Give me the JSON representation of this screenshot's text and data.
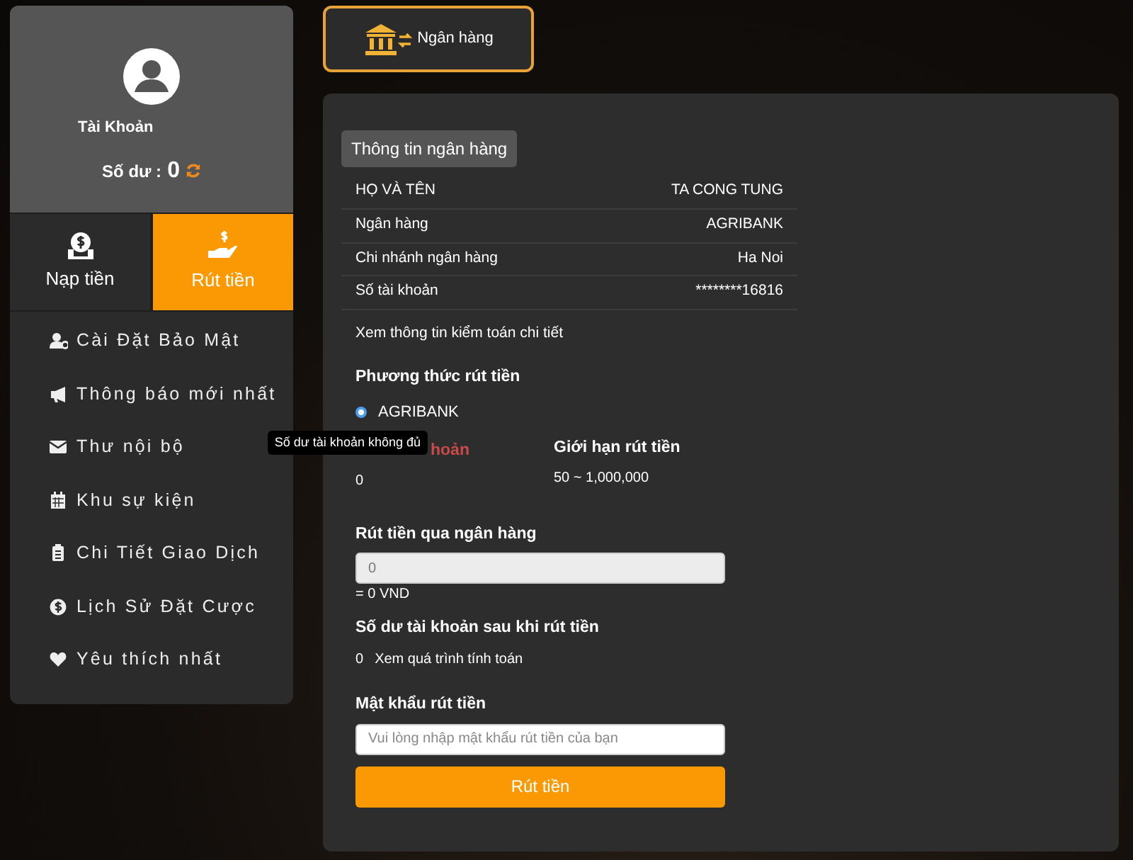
{
  "profile": {
    "account_label": "Tài Khoản",
    "balance_label": "Số dư :",
    "balance": "0"
  },
  "actions": [
    {
      "kind": "deposit",
      "label": "Nạp tiền",
      "selected": false
    },
    {
      "kind": "withdraw",
      "label": "Rút tiền",
      "selected": true
    }
  ],
  "menu": [
    {
      "kind": "security",
      "label": "Cài Đặt Bảo Mật"
    },
    {
      "kind": "megaphone",
      "label": "Thông báo mới nhất"
    },
    {
      "kind": "mail",
      "label": "Thư nội bộ"
    },
    {
      "kind": "calendar",
      "label": "Khu sự kiện"
    },
    {
      "kind": "clipboard",
      "label": "Chi Tiết Giao Dịch"
    },
    {
      "kind": "coin",
      "label": "Lịch Sử Đặt Cược"
    },
    {
      "kind": "heart",
      "label": "Yêu thích nhất"
    }
  ],
  "tab": {
    "label": "Ngân hàng",
    "selected": true
  },
  "bank_info": {
    "heading": "Thông tin ngân hàng",
    "rows": [
      {
        "label": "HỌ VÀ TÊN",
        "value": "TA CONG TUNG"
      },
      {
        "label": "Ngân hàng",
        "value": "AGRIBANK"
      },
      {
        "label": "Chi nhánh ngân hàng",
        "value": "Ha Noi"
      },
      {
        "label": "Số tài khoản",
        "value": "********16816"
      }
    ],
    "audit_link": "Xem thông tin kiểm toán chi tiết"
  },
  "withdraw_method": {
    "heading": "Phương thức rút tiền",
    "options": [
      {
        "label": "AGRIBANK",
        "selected": true
      }
    ]
  },
  "account_balance": {
    "label": "hoản",
    "value": "0",
    "tooltip": "Số dư tài khoản không đủ"
  },
  "limit": {
    "label": "Giới hạn rút tiền",
    "value": "50 ~ 1,000,000"
  },
  "amount": {
    "label": "Rút tiền qua ngân hàng",
    "placeholder": "0",
    "converted": "= 0 VND"
  },
  "after_balance": {
    "label": "Số dư tài khoản sau khi rút tiền",
    "value": "0",
    "link": "Xem quá trình tính toán"
  },
  "password": {
    "label": "Mật khẩu rút tiền",
    "placeholder": "Vui lòng nhập mật khẩu rút tiền của bạn"
  },
  "submit": "Rút tiền"
}
